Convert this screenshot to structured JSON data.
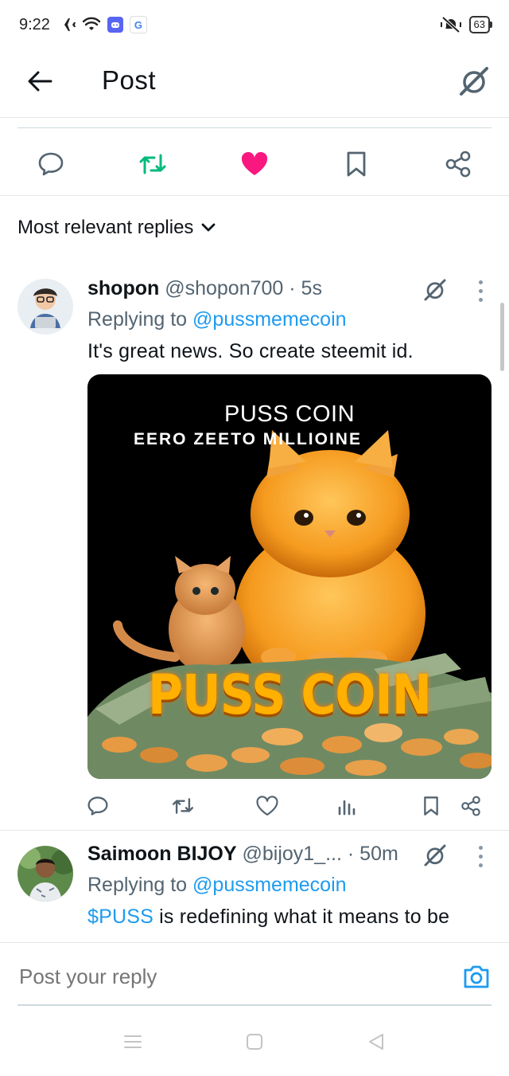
{
  "status_bar": {
    "time": "9:22",
    "battery": "63"
  },
  "header": {
    "title": "Post"
  },
  "sort": {
    "label": "Most relevant replies"
  },
  "replies": [
    {
      "name": "shopon",
      "handle": "@shopon700",
      "time": "· 5s",
      "replying_prefix": "Replying to",
      "replying_to": "@pussmemecoin",
      "text": "It's great news. So create steemit id.",
      "media": {
        "title": "PUSS COIN",
        "subtitle": "EERO ZEETO MILLIOINE",
        "brand": "PUSS COIN"
      }
    },
    {
      "name": "Saimoon BIJOY",
      "handle": "@bijoy1_...",
      "time": "· 50m",
      "replying_prefix": "Replying to",
      "replying_to": "@pussmemecoin",
      "text_cashtag": "$PUSS",
      "text": " is redefining what it means to be"
    }
  ],
  "composer": {
    "placeholder": "Post your reply"
  },
  "colors": {
    "like": "#f91880",
    "repost": "#00ba7c",
    "link": "#1d9bf0",
    "secondary": "#536471"
  },
  "icons": [
    "back-arrow-icon",
    "grok-icon",
    "reply-icon",
    "repost-icon",
    "like-icon",
    "bookmark-icon",
    "share-icon",
    "chevron-down-icon",
    "views-icon",
    "camera-icon",
    "more-icon"
  ]
}
